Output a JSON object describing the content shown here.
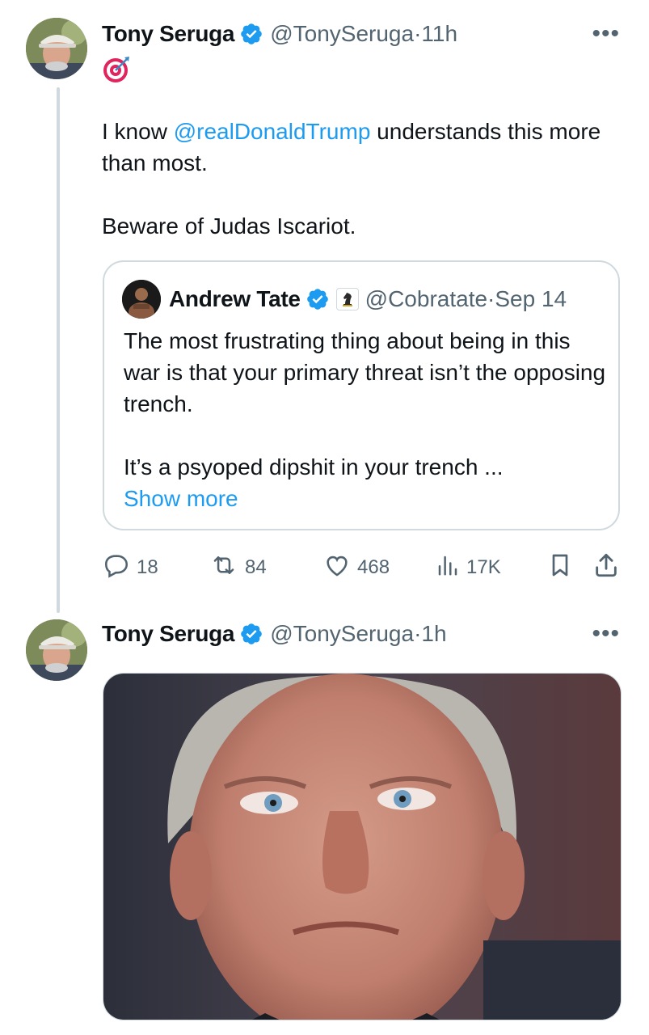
{
  "tweet1": {
    "author_name": "Tony Seruga",
    "author_handle": "@TonySeruga",
    "time": "11h",
    "text_before_mention": "I know ",
    "mention": "@realDonaldTrump",
    "text_after_mention": " understands this more than most.",
    "paragraph2": "Beware of Judas Iscariot.",
    "quote": {
      "author_name": "Andrew Tate",
      "author_handle": "@Cobratate",
      "date": "Sep 14",
      "paragraph1": "The most frustrating thing about being in this war is that your primary threat isn’t the opposing trench.",
      "paragraph2": "It’s a psyoped dipshit in your trench ...",
      "show_more": "Show more"
    },
    "actions": {
      "replies": "18",
      "retweets": "84",
      "likes": "468",
      "views": "17K"
    }
  },
  "tweet2": {
    "author_name": "Tony Seruga",
    "author_handle": "@TonySeruga",
    "time": "1h"
  },
  "separator": " · ",
  "colors": {
    "accent": "#1d9bf0",
    "secondary_text": "#536471",
    "border": "#cfd9de"
  },
  "icons": [
    "target-emoji",
    "verified-badge-icon",
    "more-icon",
    "reply-icon",
    "retweet-icon",
    "like-icon",
    "views-icon",
    "bookmark-icon",
    "share-icon",
    "chess-knight-icon"
  ]
}
